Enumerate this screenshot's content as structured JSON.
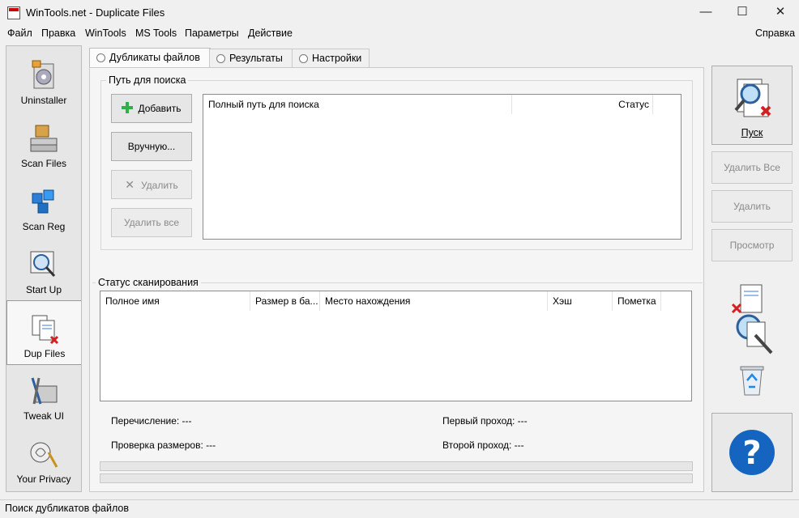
{
  "window": {
    "title": "WinTools.net - Duplicate Files"
  },
  "menu": [
    "Файл",
    "Правка",
    "WinTools",
    "MS Tools",
    "Параметры",
    "Действие"
  ],
  "menu_help": "Справка",
  "sidebar": {
    "items": [
      {
        "label": "Uninstaller",
        "icon": "uninstaller-icon"
      },
      {
        "label": "Scan Files",
        "icon": "scan-files-icon"
      },
      {
        "label": "Scan Reg",
        "icon": "scan-reg-icon"
      },
      {
        "label": "Start Up",
        "icon": "startup-icon"
      },
      {
        "label": "Dup Files",
        "icon": "dup-files-icon",
        "active": true
      },
      {
        "label": "Tweak UI",
        "icon": "tweak-ui-icon"
      },
      {
        "label": "Your Privacy",
        "icon": "privacy-icon"
      }
    ]
  },
  "tabs": [
    "Дубликаты файлов",
    "Результаты",
    "Настройки"
  ],
  "search_path": {
    "group_title": "Путь для поиска",
    "add_button": "Добавить",
    "manual_button": "Вручную...",
    "remove_button": "Удалить",
    "remove_all_button": "Удалить все",
    "columns": [
      "Полный путь для поиска",
      "Статус"
    ]
  },
  "scan_status": {
    "group_title": "Статус сканирования",
    "columns": [
      "Полное имя",
      "Размер в ба...",
      "Место нахождения",
      "Хэш",
      "Пометка"
    ],
    "enumeration": "Перечисление: ---",
    "size_check": "Проверка размеров: ---",
    "first_pass": "Первый проход: ---",
    "second_pass": "Второй проход: ---"
  },
  "right_panel": {
    "start_button": "Пуск",
    "delete_all_button": "Удалить Все",
    "delete_button": "Удалить",
    "view_button": "Просмотр"
  },
  "statusbar": {
    "text": "Поиск дубликатов файлов"
  },
  "colors": {
    "accent_blue": "#1565c0",
    "add_green": "#2bb24c",
    "delete_red": "#d32020"
  }
}
